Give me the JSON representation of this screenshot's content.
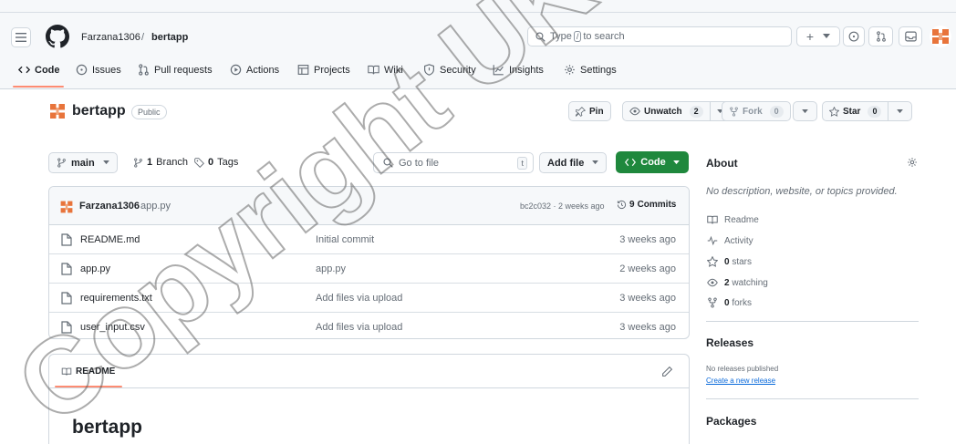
{
  "header": {
    "owner": "Farzana1306",
    "separator": "/",
    "repo": "bertapp",
    "search_prefix": "Type",
    "search_key": "/",
    "search_suffix": "to search",
    "plus_label": "+"
  },
  "nav": {
    "tabs": [
      {
        "label": "Code",
        "icon": "code-icon"
      },
      {
        "label": "Issues",
        "icon": "issue-icon"
      },
      {
        "label": "Pull requests",
        "icon": "pull-request-icon"
      },
      {
        "label": "Actions",
        "icon": "play-icon"
      },
      {
        "label": "Projects",
        "icon": "table-icon"
      },
      {
        "label": "Wiki",
        "icon": "book-icon"
      },
      {
        "label": "Security",
        "icon": "shield-icon"
      },
      {
        "label": "Insights",
        "icon": "graph-icon"
      },
      {
        "label": "Settings",
        "icon": "gear-icon"
      }
    ]
  },
  "repo": {
    "name": "bertapp",
    "visibility": "Public",
    "pin_label": "Pin",
    "watch_label": "Unwatch",
    "watch_count": "2",
    "fork_label": "Fork",
    "fork_count": "0",
    "star_label": "Star",
    "star_count": "0"
  },
  "toolbar": {
    "branch": "main",
    "branches_count": "1",
    "branches_label": "Branch",
    "tags_count": "0",
    "tags_label": "Tags",
    "goto_placeholder": "Go to file",
    "goto_key": "t",
    "add_file_label": "Add file",
    "code_label": "Code"
  },
  "latest_commit": {
    "user": "Farzana1306",
    "message": "app.py",
    "meta": "bc2c032 · 2 weeks ago",
    "commits_count": "9",
    "commits_label": "Commits"
  },
  "files": [
    {
      "name": "README.md",
      "commit": "Initial commit",
      "time": "3 weeks ago"
    },
    {
      "name": "app.py",
      "commit": "app.py",
      "time": "2 weeks ago"
    },
    {
      "name": "requirements.txt",
      "commit": "Add files via upload",
      "time": "3 weeks ago"
    },
    {
      "name": "user_input.csv",
      "commit": "Add files via upload",
      "time": "3 weeks ago"
    }
  ],
  "readme": {
    "tab_label": "README",
    "heading": "bertapp"
  },
  "sidebar": {
    "about_title": "About",
    "description": "No description, website, or topics provided.",
    "items": [
      {
        "icon": "book-icon",
        "bold": "",
        "text": "Readme"
      },
      {
        "icon": "pulse-icon",
        "bold": "",
        "text": "Activity"
      },
      {
        "icon": "star-icon",
        "bold": "0",
        "text": "stars"
      },
      {
        "icon": "eye-icon",
        "bold": "2",
        "text": "watching"
      },
      {
        "icon": "fork-icon",
        "bold": "0",
        "text": "forks"
      }
    ],
    "releases_title": "Releases",
    "releases_none": "No releases published",
    "releases_create": "Create a new release",
    "packages_title": "Packages"
  },
  "watermark": "Copyright UKM",
  "colors": {
    "accent_green": "#1f883d",
    "tab_underline": "#fd8c73",
    "link_blue": "#0969da",
    "avatar_orange": "#e8743b"
  }
}
